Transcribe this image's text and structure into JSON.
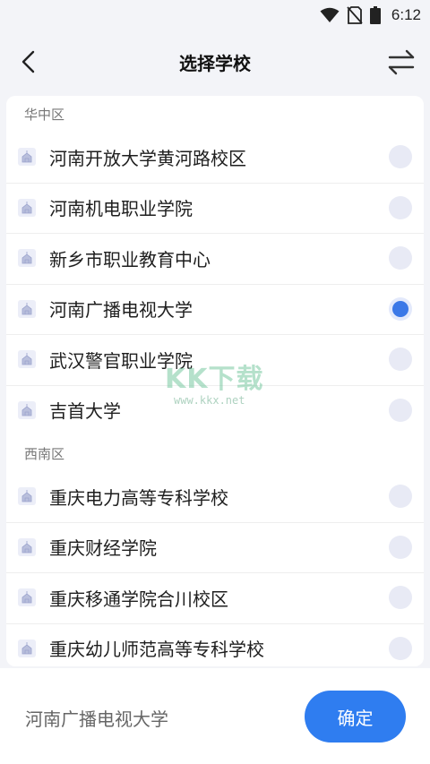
{
  "status_bar": {
    "time": "6:12"
  },
  "header": {
    "title": "选择学校"
  },
  "sections": [
    {
      "title": "华中区",
      "items": [
        {
          "name": "河南开放大学黄河路校区",
          "selected": false
        },
        {
          "name": "河南机电职业学院",
          "selected": false
        },
        {
          "name": "新乡市职业教育中心",
          "selected": false
        },
        {
          "name": "河南广播电视大学",
          "selected": true
        },
        {
          "name": "武汉警官职业学院",
          "selected": false
        },
        {
          "name": "吉首大学",
          "selected": false
        }
      ]
    },
    {
      "title": "西南区",
      "items": [
        {
          "name": "重庆电力高等专科学校",
          "selected": false
        },
        {
          "name": "重庆财经学院",
          "selected": false
        },
        {
          "name": "重庆移通学院合川校区",
          "selected": false
        },
        {
          "name": "重庆幼儿师范高等专科学校",
          "selected": false
        }
      ]
    }
  ],
  "watermark": {
    "logo": "KK下载",
    "url": "www.kkx.net"
  },
  "bottom": {
    "selected_school": "河南广播电视大学",
    "confirm_label": "确定"
  },
  "colors": {
    "accent": "#2f7df0",
    "radio_checked": "#3b78e7",
    "radio_unchecked": "#e8eaf5",
    "background": "#f3f4f8"
  }
}
